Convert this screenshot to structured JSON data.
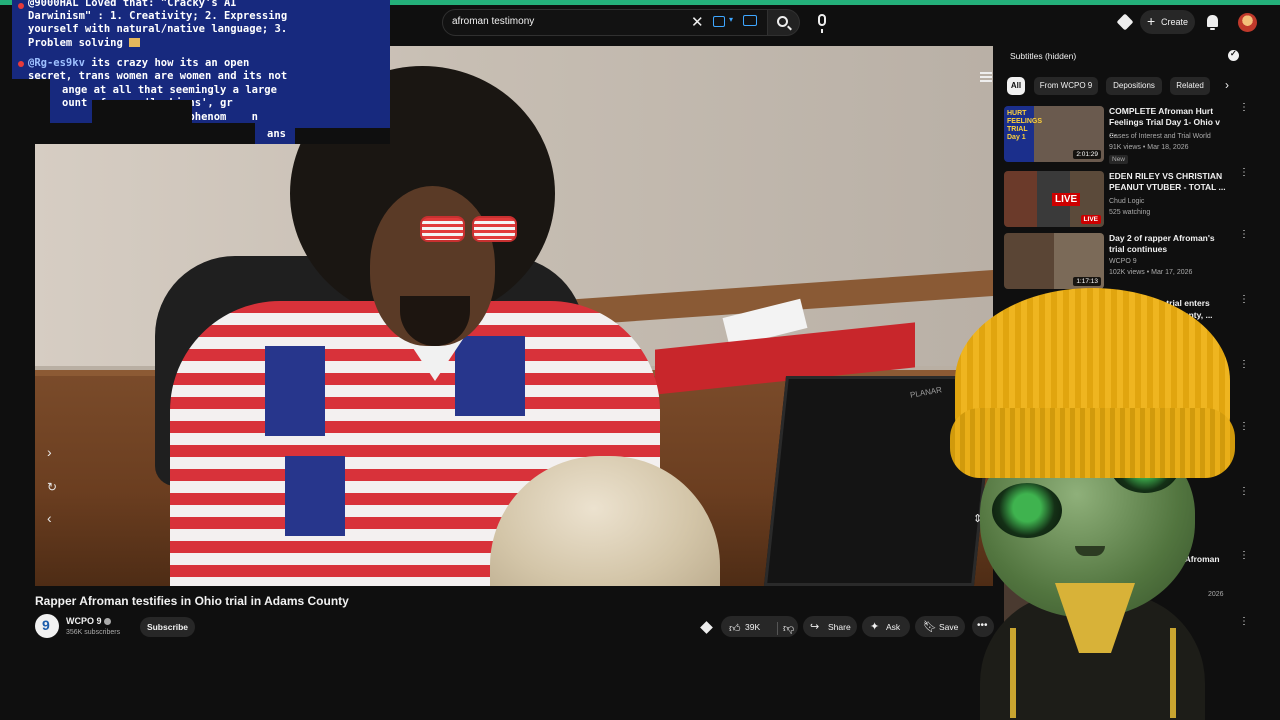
{
  "search": {
    "value": "afroman testimony"
  },
  "header": {
    "create_label": "Create"
  },
  "chat": {
    "line1": "@9000HAL Loved that: \"Cracky's AI",
    "line2": "Darwinism\" : 1. Creativity; 2. Expressing",
    "line3": "yourself with natural/native language; 3.",
    "line4": "Problem solving",
    "user2": "@Rg-es9kv",
    "line5": " its crazy how its an open",
    "line6": "secret, trans women are women and its not",
    "line7": "ange at all that seemingly a large",
    "line8": "ount of      'lesbians', gr",
    "line9": "            kind    phenom    n",
    "line10": "ans"
  },
  "video": {
    "title": "Rapper Afroman testifies in Ohio trial in Adams County",
    "monitor_brand": "PLANAR"
  },
  "channel": {
    "name": "WCPO 9",
    "subscribers": "356K subscribers",
    "subscribe_label": "Subscribe"
  },
  "actions": {
    "likes": "39K",
    "share_label": "Share",
    "ask_label": "Ask",
    "save_label": "Save"
  },
  "sidebar": {
    "subtitle_label": "Subtitles (hidden)",
    "chips": [
      "All",
      "From WCPO 9",
      "Depositions",
      "Related"
    ],
    "recs": [
      {
        "title": "COMPLETE Afroman Hurt Feelings Trial Day 1- Ohio v ...",
        "channel": "Cases of Interest and Trial World",
        "meta": "91K views • Mar 18, 2026",
        "badge": "New",
        "duration": "2:01:29",
        "thumb_text": "HURT FEELINGS TRIAL Day 1"
      },
      {
        "title": "EDEN RILEY VS CHRISTIAN PEANUT VTUBER - TOTAL ...",
        "channel": "Chud Logic",
        "meta": "525 watching",
        "live": "LIVE",
        "thumb_text": "LIVE"
      },
      {
        "title": "Day 2 of rapper Afroman's trial continues",
        "channel": "WCPO 9",
        "meta": "102K views • Mar 17, 2026",
        "duration": "1:17:13"
      },
      {
        "title_fragment_1": "n's trial enters",
        "title_fragment_2": "s County, ..."
      }
    ],
    "partial": {
      "y_fragment": "y",
      "afroman_fragment": "in Afroman",
      "year_fragment": "2026"
    }
  },
  "colors": {
    "accent_bar": "#24b07a",
    "chat_bg": "#17297e",
    "live_red": "#cc0000",
    "beanie": "#e9ae18"
  }
}
